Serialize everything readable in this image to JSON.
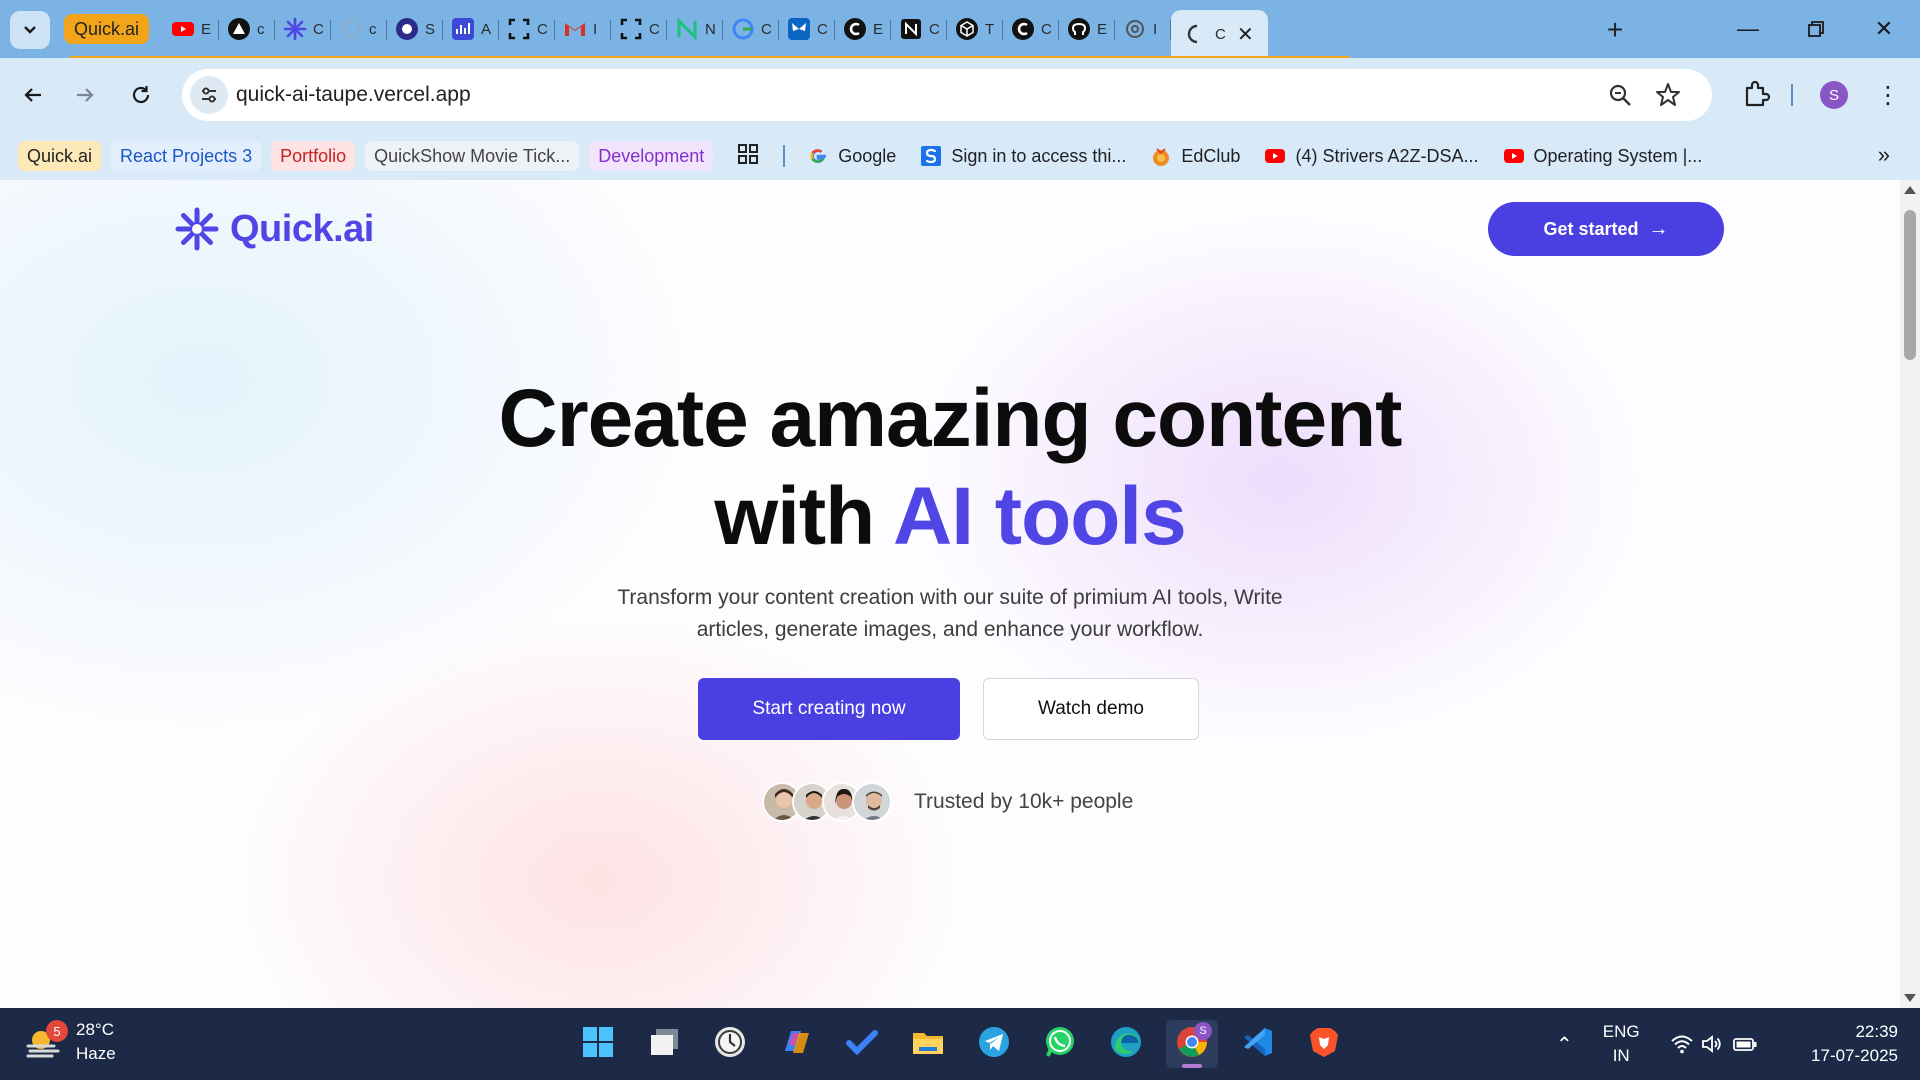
{
  "browser": {
    "tabs": [
      {
        "label": "Quick.ai",
        "kind": "group"
      },
      {
        "icon": "youtube-icon",
        "color": "#ff0000",
        "letter": "E"
      },
      {
        "icon": "triangle-app-icon",
        "color": "#111111",
        "letter": "c"
      },
      {
        "icon": "quickai-star-icon",
        "color": "#4f46e5",
        "letter": "C"
      },
      {
        "icon": "gear-outline-icon",
        "color": "#9aa6b2",
        "letter": "c"
      },
      {
        "icon": "circle-logo-icon",
        "color": "#2b2b8a",
        "letter": "S"
      },
      {
        "icon": "chart-app-icon",
        "color": "#3b49d6",
        "letter": "A"
      },
      {
        "icon": "frame-app-icon",
        "color": "#111111",
        "letter": "C"
      },
      {
        "icon": "gmail-icon",
        "color": "#d93025",
        "letter": "I"
      },
      {
        "icon": "frame-app-icon",
        "color": "#111111",
        "letter": "C"
      },
      {
        "icon": "n-app-icon",
        "color": "#19c37d",
        "letter": "N"
      },
      {
        "icon": "google-icon",
        "color": "#4285f4",
        "letter": "C"
      },
      {
        "icon": "butterfly-icon",
        "color": "#0a66c2",
        "letter": "C"
      },
      {
        "icon": "c-logo-icon",
        "color": "#111111",
        "letter": "E"
      },
      {
        "icon": "notion-icon",
        "color": "#111111",
        "letter": "C"
      },
      {
        "icon": "cube-icon",
        "color": "#111111",
        "letter": "T"
      },
      {
        "icon": "c-logo-icon",
        "color": "#111111",
        "letter": "C"
      },
      {
        "icon": "github-icon",
        "color": "#111111",
        "letter": "E"
      },
      {
        "icon": "openai-icon",
        "color": "#555555",
        "letter": "I"
      },
      {
        "icon": "loading-icon",
        "color": "#555555",
        "letter": "C",
        "active": true
      }
    ],
    "url": "quick-ai-taupe.vercel.app",
    "profile_initial": "S",
    "bookmarks": [
      {
        "label": "Quick.ai",
        "style": "chip",
        "bg": "#fde9b8",
        "fg": "#222222"
      },
      {
        "label": "React Projects 3",
        "style": "chip",
        "bg": "#e3eefc",
        "fg": "#1a56c4"
      },
      {
        "label": "Portfolio",
        "style": "chip",
        "bg": "#fde3e3",
        "fg": "#c5221f"
      },
      {
        "label": "QuickShow Movie Tick...",
        "style": "chip",
        "bg": "#eef1f5",
        "fg": "#444444"
      },
      {
        "label": "Development",
        "style": "chip",
        "bg": "#f1e4fb",
        "fg": "#8430ce"
      },
      {
        "label": "",
        "style": "apps",
        "icon": "apps-grid-icon"
      },
      {
        "label": "Google",
        "style": "link",
        "icon": "google-icon"
      },
      {
        "label": "Sign in to access thi...",
        "style": "link",
        "icon": "s-square-icon"
      },
      {
        "label": "EdClub",
        "style": "link",
        "icon": "edclub-icon"
      },
      {
        "label": "(4) Strivers A2Z-DSA...",
        "style": "link",
        "icon": "youtube-icon"
      },
      {
        "label": "Operating System |...",
        "style": "link",
        "icon": "youtube-icon"
      }
    ]
  },
  "site": {
    "logo_text": "Quick.ai",
    "nav_button": "Get started",
    "hero_line1": "Create amazing content",
    "hero_line2_prefix": "with ",
    "hero_line2_accent": "AI tools",
    "subtitle": "Transform your content creation with our suite of primium AI tools, Write articles, generate images, and enhance your workflow.",
    "primary_cta": "Start creating now",
    "secondary_cta": "Watch demo",
    "trust_text": "Trusted by 10k+ people",
    "accent_color": "#4f46e5"
  },
  "taskbar": {
    "temperature": "28°C",
    "condition": "Haze",
    "weather_badge": "5",
    "language_line1": "ENG",
    "language_line2": "IN",
    "time": "22:39",
    "date": "17-07-2025",
    "apps": [
      "windows-start-icon",
      "task-view-icon",
      "clock-app-icon",
      "copilot-icon",
      "todo-icon",
      "file-explorer-icon",
      "telegram-icon",
      "whatsapp-icon",
      "edge-icon",
      "chrome-icon",
      "vscode-icon",
      "brave-icon"
    ]
  }
}
